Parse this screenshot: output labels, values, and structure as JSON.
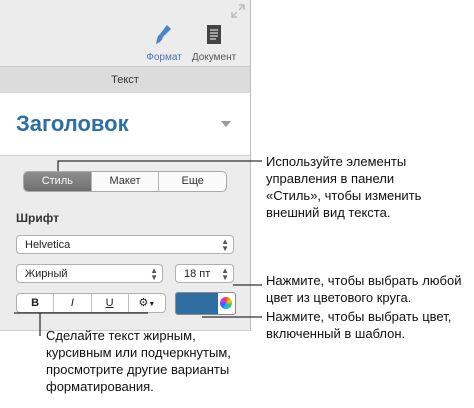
{
  "toolbar": {
    "format_label": "Формат",
    "document_label": "Документ",
    "format_icon": "paintbrush-icon",
    "document_icon": "document-icon",
    "expand_icon": "expand-arrows-icon"
  },
  "section": {
    "title": "Текст"
  },
  "paragraph_style": {
    "value": "Заголовок"
  },
  "tabs": [
    {
      "label": "Стиль",
      "selected": true
    },
    {
      "label": "Макет",
      "selected": false
    },
    {
      "label": "Еще",
      "selected": false
    }
  ],
  "font": {
    "heading": "Шрифт",
    "family": "Helvetica",
    "typeface": "Жирный",
    "size": "18 пт"
  },
  "style_buttons": {
    "bold": "B",
    "italic": "I",
    "underline": "U",
    "more_icon": "gear-icon"
  },
  "color": {
    "swatch": "#2e6ea2",
    "wheel_icon": "color-wheel-icon"
  },
  "callouts": {
    "style_panel": [
      "Используйте элементы",
      "управления в панели",
      "«Стиль», чтобы изменить",
      "внешний вид текста."
    ],
    "color_wheel": [
      "Нажмите, чтобы выбрать любой",
      "цвет из цветового круга."
    ],
    "template_color": [
      "Нажмите, чтобы выбрать цвет,",
      "включенный в шаблон."
    ],
    "text_style": [
      "Сделайте текст жирным,",
      "курсивным или подчеркнутым,",
      "просмотрите другие варианты",
      "форматирования."
    ]
  }
}
